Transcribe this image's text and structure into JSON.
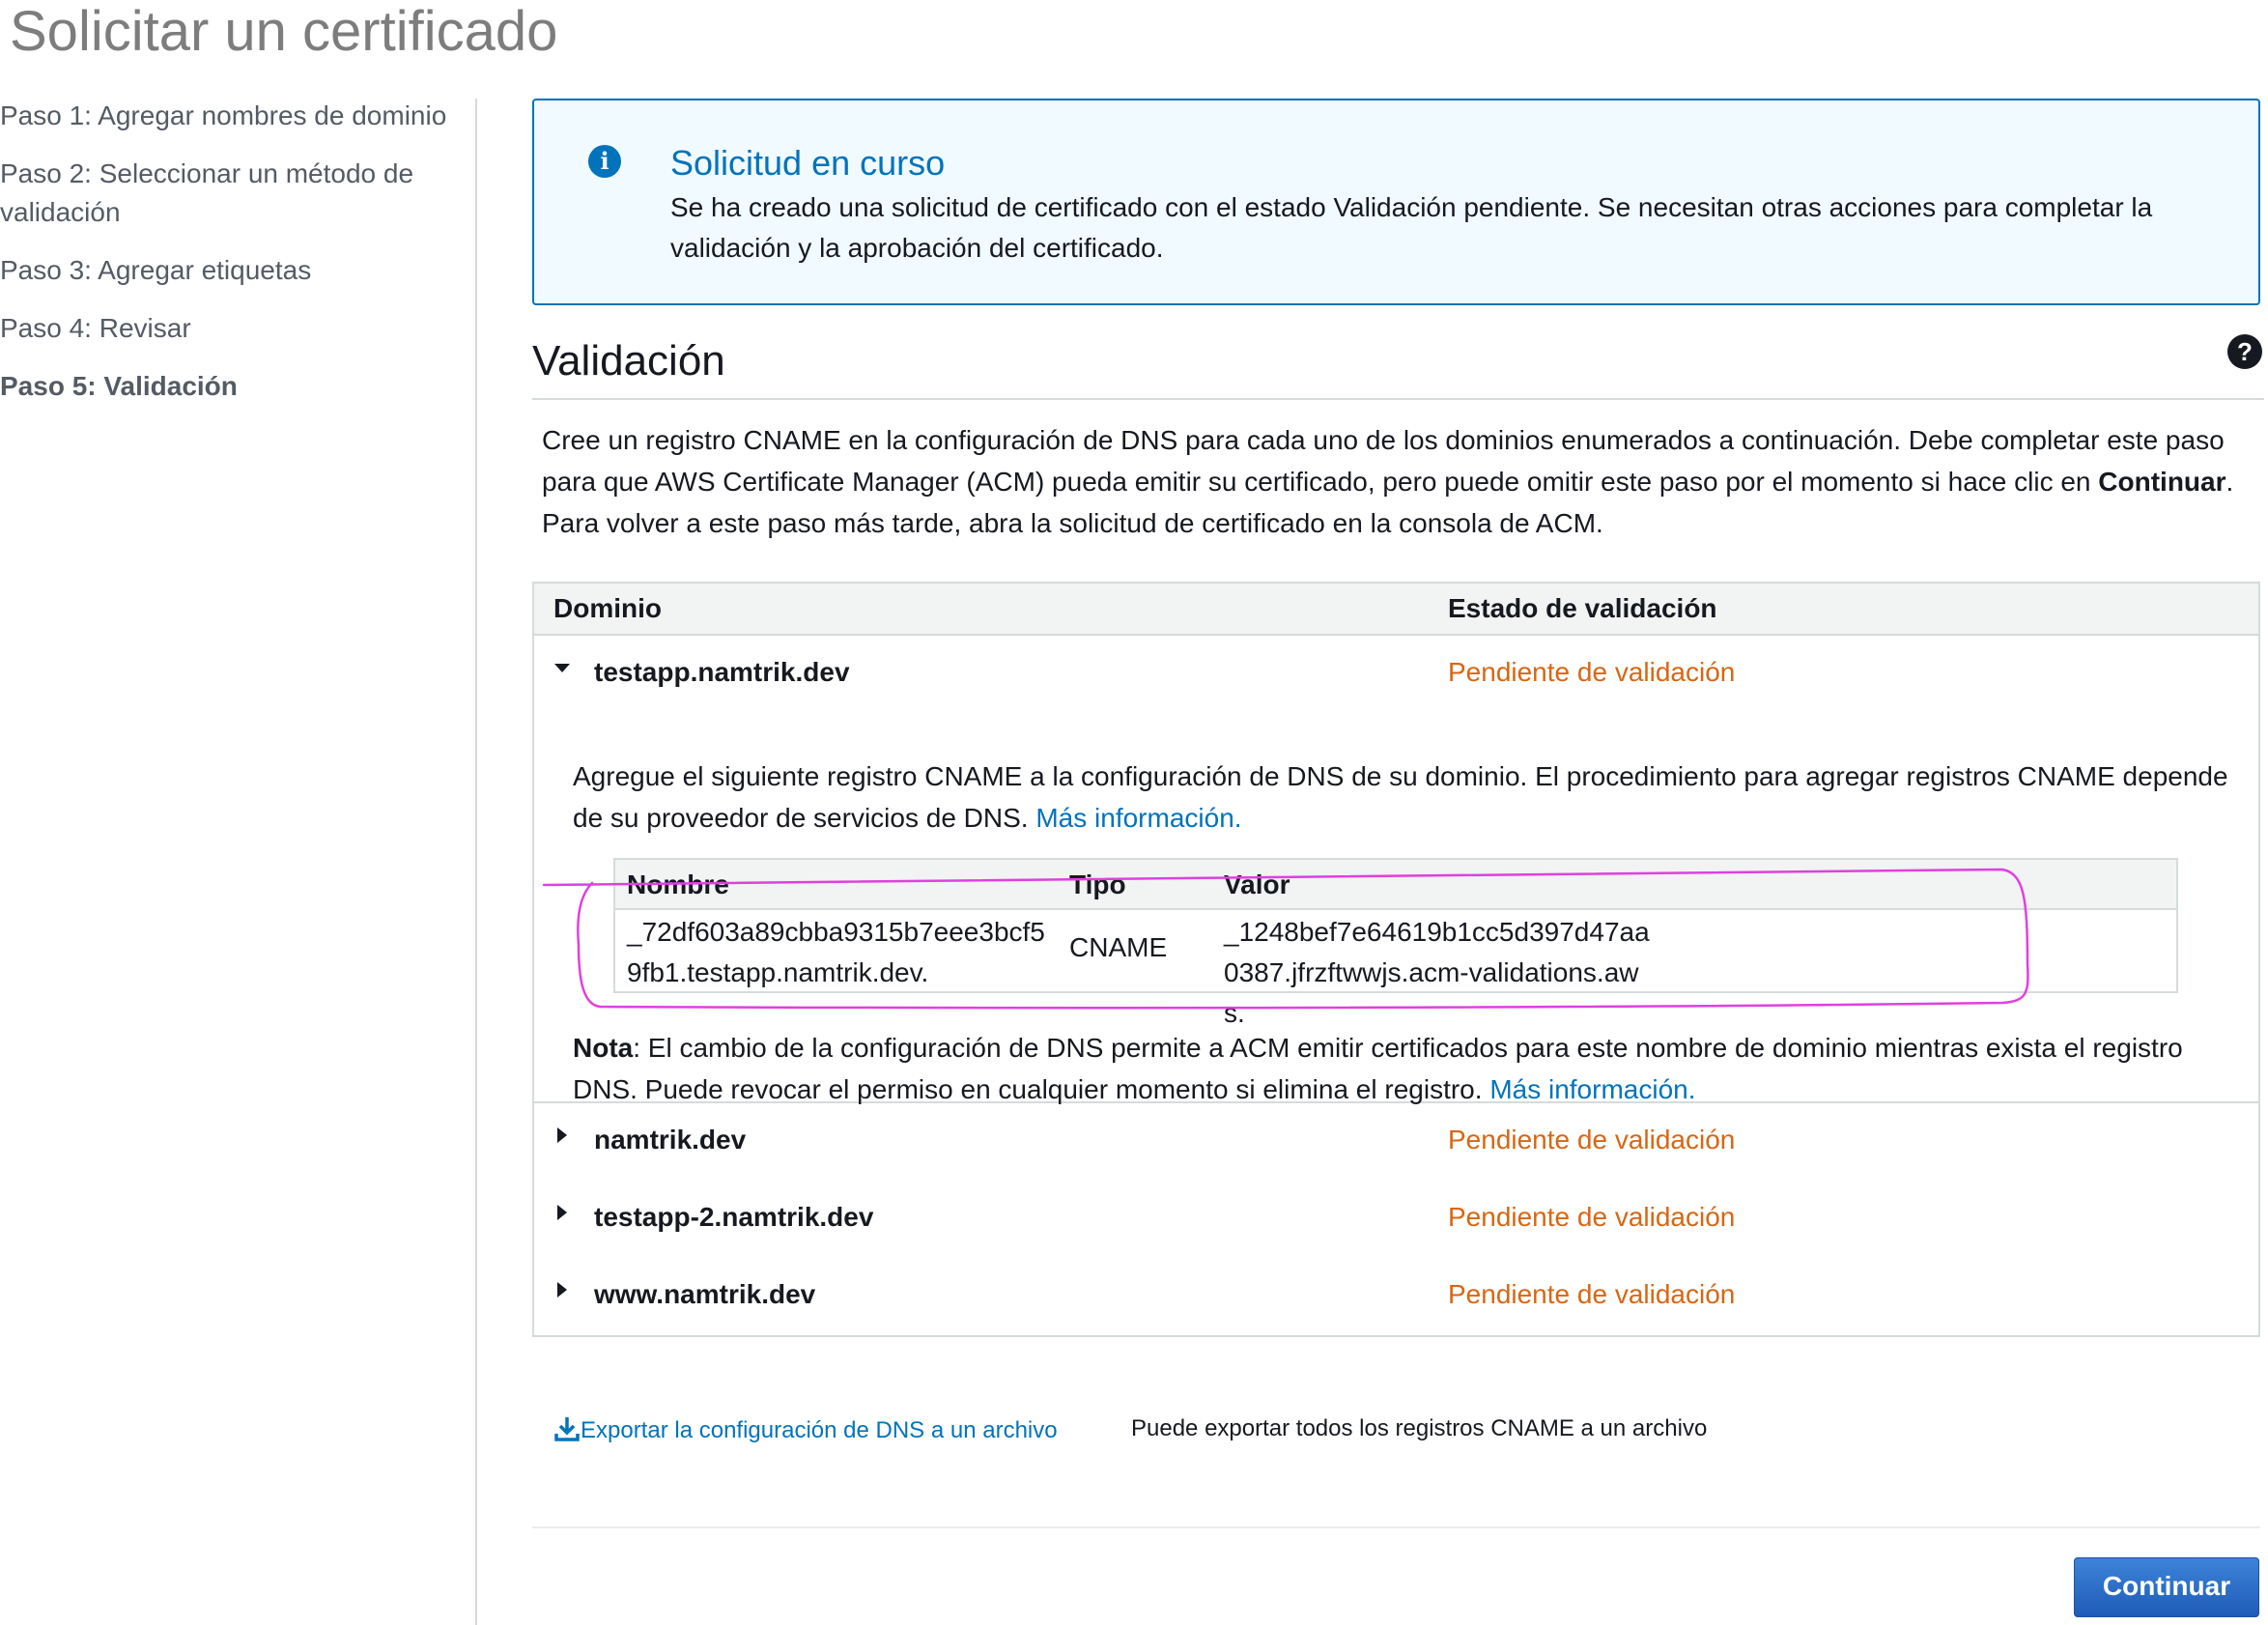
{
  "page": {
    "title": "Solicitar un certificado"
  },
  "steps": [
    {
      "label": "Paso 1: Agregar nombres de dominio"
    },
    {
      "label": "Paso 2: Seleccionar un método de validación"
    },
    {
      "label": "Paso 3: Agregar etiquetas"
    },
    {
      "label": "Paso 4: Revisar"
    },
    {
      "label": "Paso 5: Validación"
    }
  ],
  "flash": {
    "title": "Solicitud en curso",
    "text": "Se ha creado una solicitud de certificado con el estado Validación pendiente. Se necesitan otras acciones para completar la validación y la aprobación del certificado."
  },
  "section": {
    "title": "Validación",
    "intro_1": "Cree un registro CNAME en la configuración de DNS para cada uno de los dominios enumerados a continuación. Debe completar este paso para que AWS Certificate Manager (ACM) pueda emitir su certificado, pero puede omitir este paso por el momento si hace clic en ",
    "intro_bold": "Continuar",
    "intro_2": ". Para volver a este paso más tarde, abra la solicitud de certificado en la consola de ACM."
  },
  "domain_table": {
    "col_domain": "Dominio",
    "col_status": "Estado de validación",
    "expanded_row": {
      "domain": "testapp.namtrik.dev",
      "status": "Pendiente de validación",
      "instructions": "Agregue el siguiente registro CNAME a la configuración de DNS de su dominio. El procedimiento para agregar registros CNAME depende de su proveedor de servicios de DNS. ",
      "more_info": "Más información.",
      "cname": {
        "col_name": "Nombre",
        "col_type": "Tipo",
        "col_value": "Valor",
        "name": "_72df603a89cbba9315b7eee3bcf59fb1.testapp.namtrik.dev.",
        "type": "CNAME",
        "value": "_1248bef7e64619b1cc5d397d47aa0387.jfrzftwwjs.acm-validations.aws."
      },
      "note_label": "Nota",
      "note_text": ": El cambio de la configuración de DNS permite a ACM emitir certificados para este nombre de dominio mientras exista el registro DNS. Puede revocar el permiso en cualquier momento si elimina el registro. ",
      "note_link": "Más información."
    },
    "rows": [
      {
        "domain": "namtrik.dev",
        "status": "Pendiente de validación"
      },
      {
        "domain": "testapp-2.namtrik.dev",
        "status": "Pendiente de validación"
      },
      {
        "domain": "www.namtrik.dev",
        "status": "Pendiente de validación"
      }
    ]
  },
  "export": {
    "link": "Exportar la configuración de DNS a un archivo",
    "hint": "Puede exportar todos los registros CNAME a un archivo"
  },
  "buttons": {
    "continue": "Continuar"
  },
  "colors": {
    "accent": "#0073bb",
    "pending": "#d86613",
    "annotation": "#e040e0"
  }
}
